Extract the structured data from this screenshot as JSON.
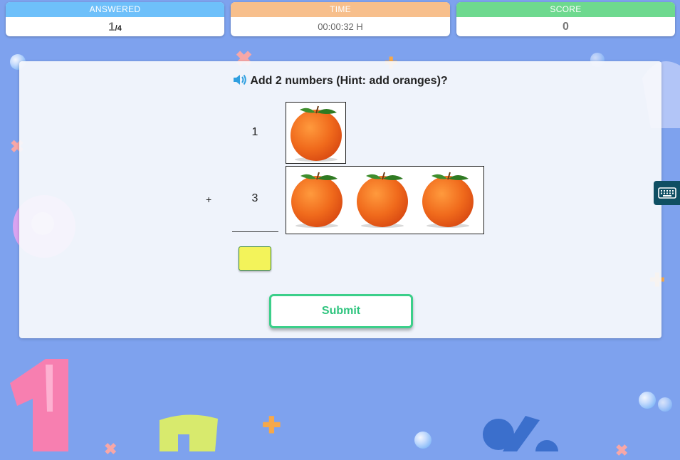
{
  "stats": {
    "answered": {
      "header": "ANSWERED",
      "current": "1",
      "total": "/4"
    },
    "time": {
      "header": "TIME",
      "value": "00:00:32 H"
    },
    "score": {
      "header": "SCORE",
      "value": "0"
    }
  },
  "question": {
    "text": "Add 2 numbers (Hint: add oranges)?",
    "icon": "speaker-icon"
  },
  "problem": {
    "first_number": "1",
    "operator": "+",
    "second_number": "3",
    "first_oranges": 1,
    "second_oranges": 3,
    "answer_value": ""
  },
  "buttons": {
    "submit_label": "Submit",
    "keyboard_icon": "keyboard-icon"
  },
  "colors": {
    "answered_header": "#6ec0fa",
    "time_header": "#f7bf8c",
    "score_header": "#6ed98f",
    "submit_accent": "#3ccf8a",
    "answer_box": "#f3f35a"
  }
}
